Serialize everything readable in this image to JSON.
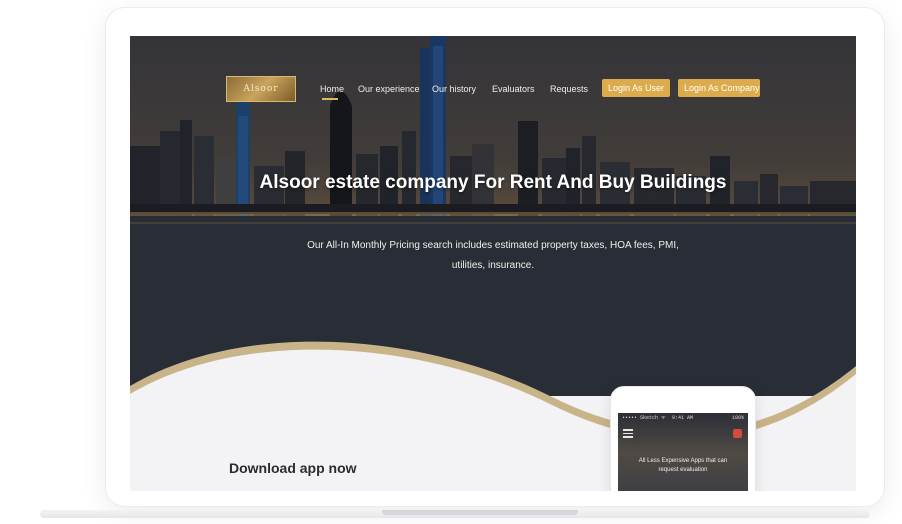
{
  "nav": {
    "logo_text": "Alsoor",
    "links": [
      "Home",
      "Our experience",
      "Our history",
      "Evaluators",
      "Requests"
    ],
    "login_user": "Login As User",
    "login_company": "Login As Company"
  },
  "hero": {
    "title": "Alsoor estate company For Rent And Buy Buildings",
    "subtitle": "Our All-In Monthly Pricing search includes estimated property taxes, HOA fees, PMI, utilities, insurance."
  },
  "download": {
    "heading": "Download app now"
  },
  "phone": {
    "carrier": "••••• Sketch ᯤ",
    "time": "9:41 AM",
    "battery": "100%",
    "screen_text": "All Less Expensive Apps that can request evaluation"
  },
  "colors": {
    "accent_gold": "#dcac4c",
    "curve_gold": "#c9b48a",
    "page_bg": "#f3f3f6"
  }
}
